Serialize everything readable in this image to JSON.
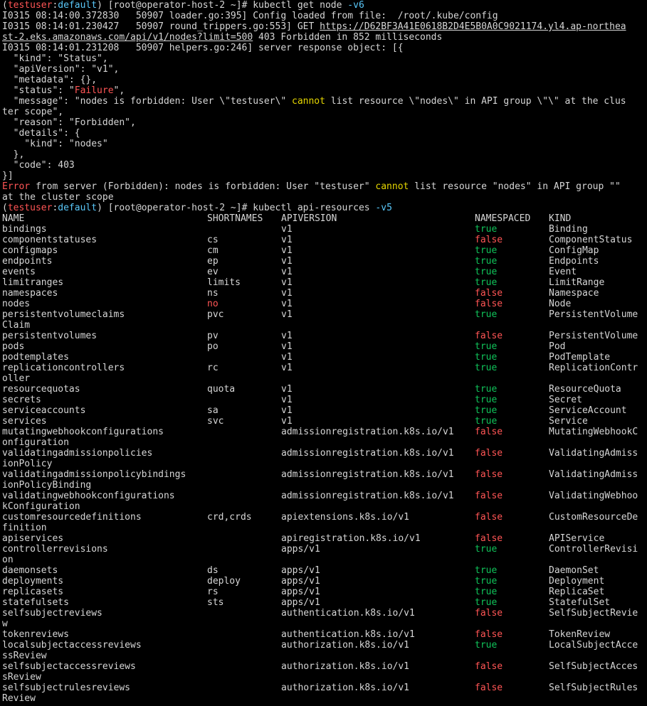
{
  "colors": {
    "background": "#000000",
    "text": "#d6d6d6",
    "true": "#10c35a",
    "false": "#ff5555",
    "prompt_user": "#ff5555",
    "prompt_ctx": "#5ac8fa",
    "highlight": "#e5d600"
  },
  "prompt1": {
    "user": "testuser",
    "ctx": "default",
    "host": "[root@operator-host-2 ~]# ",
    "cmd": "kubectl get node ",
    "flag": "-v6"
  },
  "log": {
    "l1": "I0315 08:14:00.372830   50907 loader.go:395] Config loaded from file:  /root/.kube/config",
    "l2a": "I0315 08:14:01.230427   50907 round_trippers.go:553] GET ",
    "l2url1": "https://D62BF3A41E0618B2D4E5B0A0C9021174.yl4.ap-northea",
    "l3url2": "st-2.eks.amazonaws.com/api/v1/nodes?limit=500",
    "l3b": " 403 Forbidden in 852 milliseconds",
    "l4": "I0315 08:14:01.231208   50907 helpers.go:246] server response object: [{",
    "j1": "  \"kind\": \"Status\",",
    "j2": "  \"apiVersion\": \"v1\",",
    "j3": "  \"metadata\": {},",
    "j4a": "  \"status\": \"",
    "j4b": "Failure",
    "j4c": "\",",
    "j5a": "  \"message\": \"nodes is forbidden: User \\\"testuser\\\" ",
    "j5b": "cannot",
    "j5c": " list resource \\\"nodes\\\" in API group \\\"\\\" at the clus",
    "j6": "ter scope\",",
    "j7": "  \"reason\": \"Forbidden\",",
    "j8": "  \"details\": {",
    "j9": "    \"kind\": \"nodes\"",
    "j10": "  },",
    "j11": "  \"code\": 403",
    "j12": "}]"
  },
  "error": {
    "a": "Error",
    "b": " from server (Forbidden): nodes is forbidden: User \"testuser\" ",
    "c": "cannot",
    "d": " list resource \"nodes\" in API group \"\"",
    "e": "at the cluster scope"
  },
  "prompt2": {
    "user": "testuser",
    "ctx": "default",
    "host": "[root@operator-host-2 ~]# ",
    "cmd": "kubectl api-resources ",
    "flag": "-v5"
  },
  "table": {
    "headers": [
      "NAME",
      "SHORTNAMES",
      "APIVERSION",
      "NAMESPACED",
      "KIND"
    ],
    "rows": [
      [
        "bindings",
        "",
        "v1",
        "true",
        "Binding"
      ],
      [
        "componentstatuses",
        "cs",
        "v1",
        "false",
        "ComponentStatus"
      ],
      [
        "configmaps",
        "cm",
        "v1",
        "true",
        "ConfigMap"
      ],
      [
        "endpoints",
        "ep",
        "v1",
        "true",
        "Endpoints"
      ],
      [
        "events",
        "ev",
        "v1",
        "true",
        "Event"
      ],
      [
        "limitranges",
        "limits",
        "v1",
        "true",
        "LimitRange"
      ],
      [
        "namespaces",
        "ns",
        "v1",
        "false",
        "Namespace"
      ],
      [
        "nodes",
        "no",
        "v1",
        "false",
        "Node"
      ],
      [
        "persistentvolumeclaims",
        "pvc",
        "v1",
        "true",
        "PersistentVolume"
      ],
      [
        "Claim"
      ],
      [
        "persistentvolumes",
        "pv",
        "v1",
        "false",
        "PersistentVolume"
      ],
      [
        "pods",
        "po",
        "v1",
        "true",
        "Pod"
      ],
      [
        "podtemplates",
        "",
        "v1",
        "true",
        "PodTemplate"
      ],
      [
        "replicationcontrollers",
        "rc",
        "v1",
        "true",
        "ReplicationContr"
      ],
      [
        "oller"
      ],
      [
        "resourcequotas",
        "quota",
        "v1",
        "true",
        "ResourceQuota"
      ],
      [
        "secrets",
        "",
        "v1",
        "true",
        "Secret"
      ],
      [
        "serviceaccounts",
        "sa",
        "v1",
        "true",
        "ServiceAccount"
      ],
      [
        "services",
        "svc",
        "v1",
        "true",
        "Service"
      ],
      [
        "mutatingwebhookconfigurations",
        "",
        "admissionregistration.k8s.io/v1",
        "false",
        "MutatingWebhookC"
      ],
      [
        "onfiguration"
      ],
      [
        "validatingadmissionpolicies",
        "",
        "admissionregistration.k8s.io/v1",
        "false",
        "ValidatingAdmiss"
      ],
      [
        "ionPolicy"
      ],
      [
        "validatingadmissionpolicybindings",
        "",
        "admissionregistration.k8s.io/v1",
        "false",
        "ValidatingAdmiss"
      ],
      [
        "ionPolicyBinding"
      ],
      [
        "validatingwebhookconfigurations",
        "",
        "admissionregistration.k8s.io/v1",
        "false",
        "ValidatingWebhoo"
      ],
      [
        "kConfiguration"
      ],
      [
        "customresourcedefinitions",
        "crd,crds",
        "apiextensions.k8s.io/v1",
        "false",
        "CustomResourceDe"
      ],
      [
        "finition"
      ],
      [
        "apiservices",
        "",
        "apiregistration.k8s.io/v1",
        "false",
        "APIService"
      ],
      [
        "controllerrevisions",
        "",
        "apps/v1",
        "true",
        "ControllerRevisi"
      ],
      [
        "on"
      ],
      [
        "daemonsets",
        "ds",
        "apps/v1",
        "true",
        "DaemonSet"
      ],
      [
        "deployments",
        "deploy",
        "apps/v1",
        "true",
        "Deployment"
      ],
      [
        "replicasets",
        "rs",
        "apps/v1",
        "true",
        "ReplicaSet"
      ],
      [
        "statefulsets",
        "sts",
        "apps/v1",
        "true",
        "StatefulSet"
      ],
      [
        "selfsubjectreviews",
        "",
        "authentication.k8s.io/v1",
        "false",
        "SelfSubjectRevie"
      ],
      [
        "w"
      ],
      [
        "tokenreviews",
        "",
        "authentication.k8s.io/v1",
        "false",
        "TokenReview"
      ],
      [
        "localsubjectaccessreviews",
        "",
        "authorization.k8s.io/v1",
        "true",
        "LocalSubjectAcce"
      ],
      [
        "ssReview"
      ],
      [
        "selfsubjectaccessreviews",
        "",
        "authorization.k8s.io/v1",
        "false",
        "SelfSubjectAcces"
      ],
      [
        "sReview"
      ],
      [
        "selfsubjectrulesreviews",
        "",
        "authorization.k8s.io/v1",
        "false",
        "SelfSubjectRules"
      ],
      [
        "Review"
      ]
    ]
  }
}
